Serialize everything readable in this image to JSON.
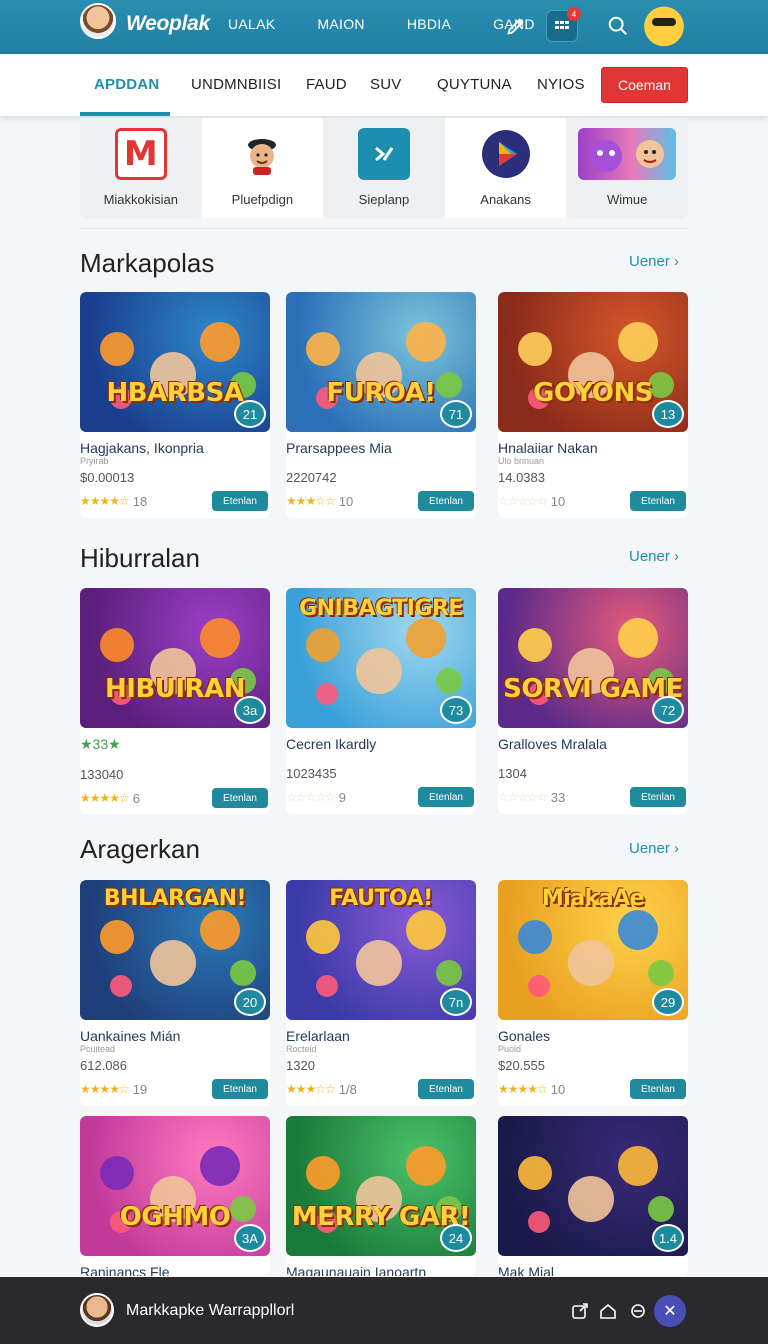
{
  "header": {
    "brand": "Weoplak",
    "nav": [
      "UALAK",
      "MAION",
      "HBDIA",
      "GAND"
    ],
    "notification_count": "4"
  },
  "tabs": {
    "items": [
      "APDDAN",
      "UNDMNBIISI",
      "FAUD",
      "SUV",
      "QUYTUNA",
      "NYIOS"
    ],
    "active": "APDDAN",
    "cta": "Coeman"
  },
  "categories": [
    {
      "label": "Miakkokisian",
      "icon": "m-logo-icon"
    },
    {
      "label": "Pluefpdign",
      "icon": "person-icon"
    },
    {
      "label": "Sieplanp",
      "icon": "chevron-app-icon"
    },
    {
      "label": "Anakans",
      "icon": "play-store-icon"
    },
    {
      "label": "Wimue",
      "icon": "game-characters-icon"
    }
  ],
  "sections": [
    {
      "title": "Markapolas",
      "more": "Uener",
      "cards": [
        {
          "thumb_title": "HBARBSA",
          "count": "21",
          "name": "Hagjakans, Ikonpria",
          "sub": "Pryirab",
          "num": "$0.00013",
          "stars": "★★★★☆",
          "rating": "18",
          "get": "Etenlan",
          "colors": [
            "#1b3f8f",
            "#2d86c9",
            "#ff9a2a"
          ]
        },
        {
          "thumb_title": "FUROA!",
          "count": "71",
          "name": "Prarsappees Mia",
          "sub": "",
          "num": "2220742",
          "stars": "★★★☆☆",
          "rating": "10",
          "get": "Etenlan",
          "colors": [
            "#2a6fb8",
            "#7ac4d9",
            "#ffb347"
          ]
        },
        {
          "thumb_title": "GOYONS",
          "count": "13",
          "name": "Hnalaiiar Nakan",
          "sub": "Ulo bnnuan",
          "num": "14.0383",
          "stars": "☆☆☆☆☆",
          "rating": "10",
          "get": "Etenlan",
          "colors": [
            "#8a2a1a",
            "#d4562a",
            "#ffcf5a"
          ]
        }
      ]
    },
    {
      "title": "Hiburralan",
      "more": "Uener",
      "cards": [
        {
          "thumb_title": "HIBUIRAN",
          "count": "3a",
          "name": "★33★",
          "sub": "",
          "num": "133040",
          "stars": "★★★★☆",
          "rating": "6",
          "get": "Etenlan",
          "colors": [
            "#5a1f7a",
            "#9b3fc7",
            "#ff8a2a"
          ]
        },
        {
          "thumb_title": "GNIBAGTIGRE",
          "count": "73",
          "name": "Cecren Ikardly",
          "sub": "",
          "num": "1023435",
          "stars": "☆☆☆☆☆",
          "rating": "9",
          "get": "Etenlan",
          "colors": [
            "#3aa0d8",
            "#9fd7f0",
            "#f0a030"
          ]
        },
        {
          "thumb_title": "SORVI GAME",
          "count": "72",
          "name": "Gralloves Mralala",
          "sub": "",
          "num": "1304",
          "stars": "☆☆☆☆☆",
          "rating": "33",
          "get": "Etenlan",
          "colors": [
            "#5b2a8a",
            "#e55a7a",
            "#ffd24a"
          ]
        }
      ]
    },
    {
      "title": "Aragerkan",
      "more": "Uener",
      "cards": [
        {
          "thumb_title": "BHLARGAN!",
          "count": "20",
          "name": "Uankaines Mián",
          "sub": "Pcuitead",
          "num": "612.086",
          "stars": "★★★★☆",
          "rating": "19",
          "get": "Etenlan",
          "colors": [
            "#1f3f7a",
            "#2a7ab8",
            "#ff9a2a"
          ]
        },
        {
          "thumb_title": "FAUTOA!",
          "count": "7n",
          "name": "Erelarlaan",
          "sub": "Rocteid",
          "num": "1320",
          "stars": "★★★☆☆",
          "rating": "1/8",
          "get": "Etenlan",
          "colors": [
            "#3a3aa8",
            "#8a5ad8",
            "#ffc93a"
          ]
        },
        {
          "thumb_title": "MiakaAe",
          "count": "29",
          "name": "Gonales",
          "sub": "Puoid",
          "num": "$20.555",
          "stars": "★★★★☆",
          "rating": "10",
          "get": "Etenlan",
          "colors": [
            "#e8a020",
            "#ffd24a",
            "#3a8ad8"
          ]
        }
      ]
    },
    {
      "title": "",
      "more": "",
      "cards": [
        {
          "thumb_title": "OGHMO",
          "count": "3A",
          "name": "Raninancs Fle",
          "colors": [
            "#c23a9a",
            "#ff7ac0",
            "#7a2ab8"
          ]
        },
        {
          "thumb_title": "MERRY GAR!",
          "count": "24",
          "name": "Magaunauain Ianoartn",
          "colors": [
            "#1a7a3a",
            "#4ac26a",
            "#ff9a2a"
          ]
        },
        {
          "thumb_title": "",
          "count": "1.4",
          "name": "Mak Mial",
          "colors": [
            "#1a1a4a",
            "#3a2a7a",
            "#ffb83a"
          ]
        }
      ]
    }
  ],
  "bottom": {
    "name": "Markkapke Warrappllorl"
  }
}
